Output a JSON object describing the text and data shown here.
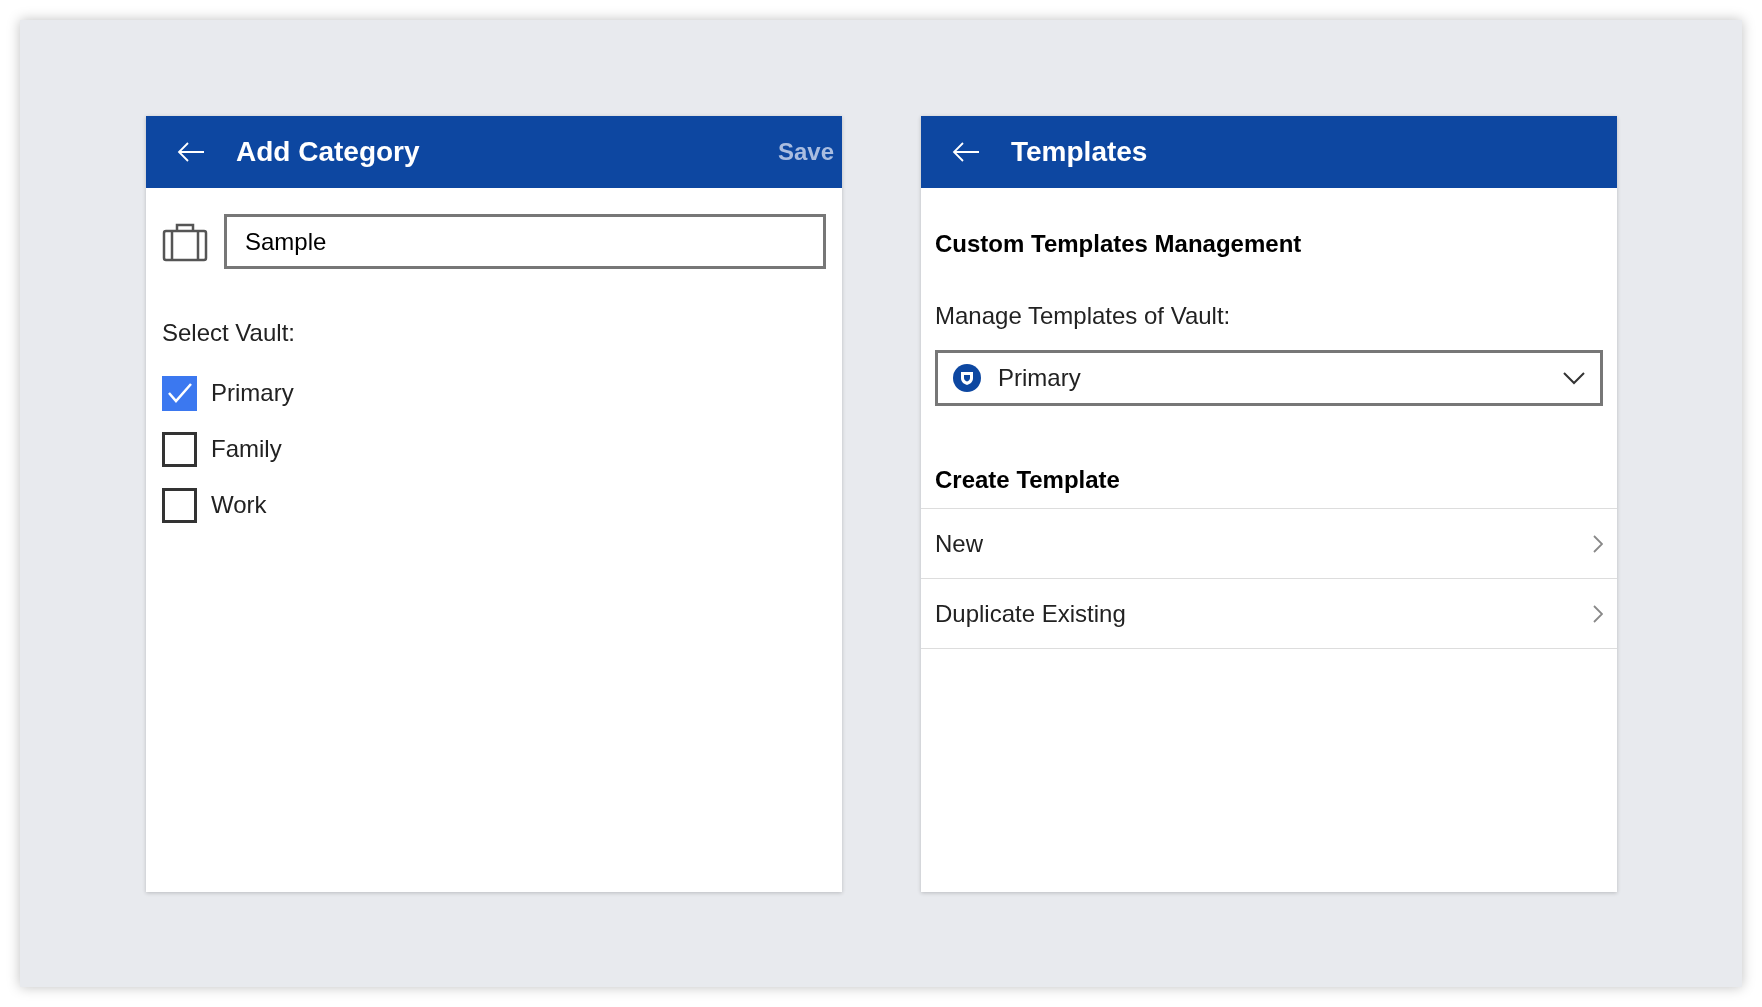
{
  "left_panel": {
    "title": "Add Category",
    "save_button": {
      "label": "Save",
      "disabled": true
    },
    "name_field": {
      "value": "Sample"
    },
    "vault_label": "Select Vault:",
    "vaults": [
      {
        "label": "Primary",
        "checked": true
      },
      {
        "label": "Family",
        "checked": false
      },
      {
        "label": "Work",
        "checked": false
      }
    ]
  },
  "right_panel": {
    "title": "Templates",
    "section_title": "Custom Templates Management",
    "vault_label": "Manage Templates of Vault:",
    "vault_select": {
      "value": "Primary"
    },
    "create_title": "Create Template",
    "items": [
      {
        "label": "New"
      },
      {
        "label": "Duplicate Existing"
      }
    ]
  }
}
